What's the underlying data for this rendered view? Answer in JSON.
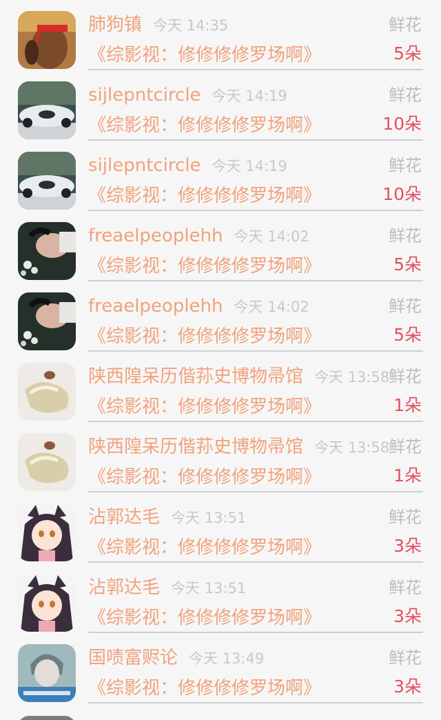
{
  "colors": {
    "background": "#f7f6f6",
    "name": "#f0a27c",
    "time": "#c8c8c8",
    "gift_type": "#bdbdbd",
    "count": "#e25060",
    "divider": "#cfcfcf"
  },
  "items": [
    {
      "avatar": "avatar-red-bandana-photo",
      "name": "肺狗镇",
      "time": "今天 14:35",
      "gift_type": "鲜花",
      "book": "《综影视：修修修修罗场啊》",
      "count": "5朵"
    },
    {
      "avatar": "avatar-concept-car-photo",
      "name": "sijlepntcircle",
      "time": "今天 14:19",
      "gift_type": "鲜花",
      "book": "《综影视：修修修修罗场啊》",
      "count": "10朵"
    },
    {
      "avatar": "avatar-concept-car-photo",
      "name": "sijlepntcircle",
      "time": "今天 14:19",
      "gift_type": "鲜花",
      "book": "《综影视：修修修修罗场啊》",
      "count": "10朵"
    },
    {
      "avatar": "avatar-person-flowers-photo",
      "name": "freaelpeoplehh",
      "time": "今天 14:02",
      "gift_type": "鲜花",
      "book": "《综影视：修修修修罗场啊》",
      "count": "5朵"
    },
    {
      "avatar": "avatar-person-flowers-photo",
      "name": "freaelpeoplehh",
      "time": "今天 14:02",
      "gift_type": "鲜花",
      "book": "《综影视：修修修修罗场啊》",
      "count": "5朵"
    },
    {
      "avatar": "avatar-pearl-shell-photo",
      "name": "陕西隍呆历偕荪史博物帚馆",
      "time": "今天 13:58",
      "gift_type": "鲜花",
      "book": "《综影视：修修修修罗场啊》",
      "count": "1朵"
    },
    {
      "avatar": "avatar-pearl-shell-photo",
      "name": "陕西隍呆历偕荪史博物帚馆",
      "time": "今天 13:58",
      "gift_type": "鲜花",
      "book": "《综影视：修修修修罗场啊》",
      "count": "1朵"
    },
    {
      "avatar": "avatar-anime-catgirl",
      "name": "沾郭达毛",
      "time": "今天 13:51",
      "gift_type": "鲜花",
      "book": "《综影视：修修修修罗场啊》",
      "count": "3朵"
    },
    {
      "avatar": "avatar-anime-catgirl",
      "name": "沾郭达毛",
      "time": "今天 13:51",
      "gift_type": "鲜花",
      "book": "《综影视：修修修修罗场啊》",
      "count": "3朵"
    },
    {
      "avatar": "avatar-boy-photo",
      "name": "国啧富赆论",
      "time": "今天 13:49",
      "gift_type": "鲜花",
      "book": "《综影视：修修修修罗场啊》",
      "count": "3朵"
    }
  ]
}
